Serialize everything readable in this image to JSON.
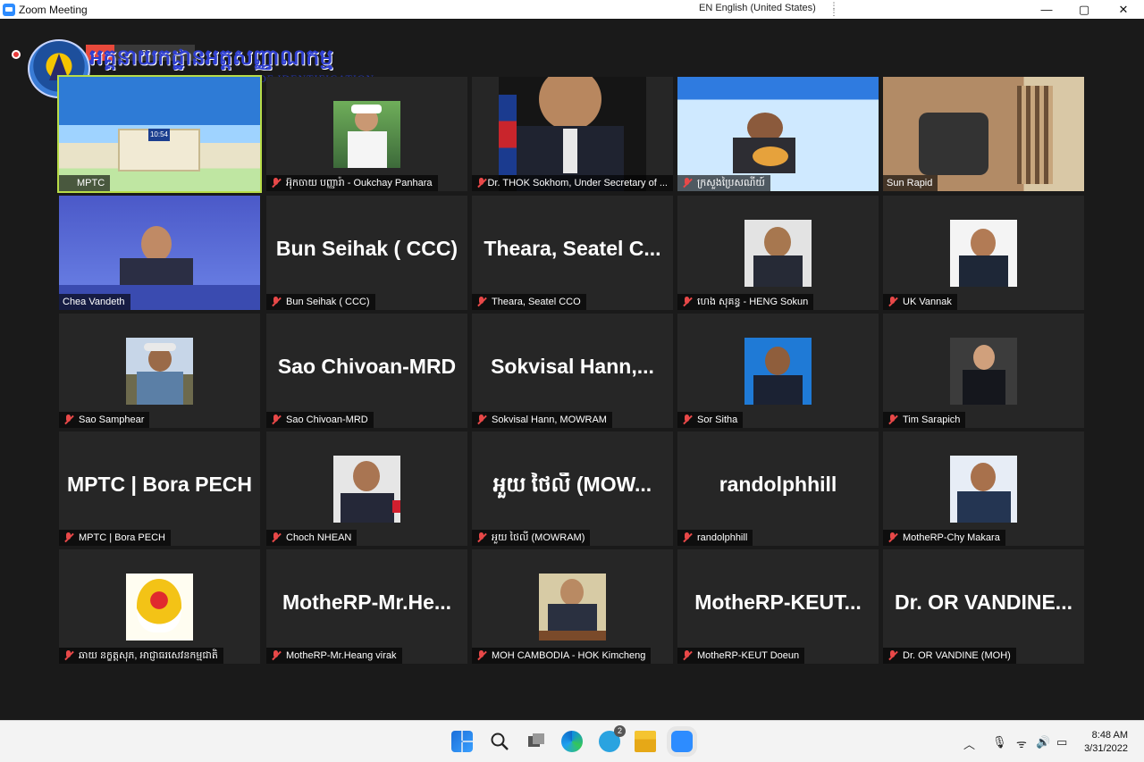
{
  "window": {
    "title": "Zoom Meeting",
    "language": "EN English (United States)",
    "lang_switch": "⋮\n⋮",
    "minimize": "—",
    "maximize": "▢",
    "close": "✕"
  },
  "banner": {
    "khmer_title": "អគ្គនាយកដ្ឋានអត្តសញ្ញាណកម្ម",
    "english_title": "GENERAL DEPARTMENT OF IDENTIFICATION",
    "recording_label": "ss"
  },
  "tiles": [
    {
      "name": "MPTC",
      "big": "",
      "type": "slide",
      "muted": false,
      "speaker": true
    },
    {
      "name": "អ៊ុកចាយ បញ្ញារ៉ា - Oukchay Panhara",
      "big": "",
      "type": "photo-officer",
      "muted": true
    },
    {
      "name": "Dr. THOK Sokhom, Under Secretary of ...",
      "big": "",
      "type": "video-suit",
      "muted": true
    },
    {
      "name": "ក្រសួងប្រៃសណីយ៍",
      "big": "",
      "type": "video-slide",
      "muted": true
    },
    {
      "name": "Sun Rapid",
      "big": "",
      "type": "video-chair",
      "muted": false
    },
    {
      "name": "Chea Vandeth",
      "big": "",
      "type": "video-presenter",
      "muted": false
    },
    {
      "name": "Bun Seihak ( CCC)",
      "big": "Bun Seihak ( CCC)",
      "type": "text",
      "muted": true
    },
    {
      "name": "Theara, Seatel CCO",
      "big": "Theara, Seatel C...",
      "type": "text",
      "muted": true
    },
    {
      "name": "ហេង សុគន្ធ - HENG Sokun",
      "big": "",
      "type": "photo-grey",
      "muted": true
    },
    {
      "name": "UK Vannak",
      "big": "",
      "type": "photo-white",
      "muted": true
    },
    {
      "name": "Sao Samphear",
      "big": "",
      "type": "photo-outdoor",
      "muted": true
    },
    {
      "name": "Sao Chivoan-MRD",
      "big": "Sao Chivoan-MRD",
      "type": "text",
      "muted": true
    },
    {
      "name": "Sokvisal Hann, MOWRAM",
      "big": "Sokvisal Hann,...",
      "type": "text",
      "muted": true
    },
    {
      "name": "Sor Sitha",
      "big": "",
      "type": "photo-blue",
      "muted": true
    },
    {
      "name": "Tim Sarapich",
      "big": "",
      "type": "photo-dark",
      "muted": true
    },
    {
      "name": "MPTC | Bora PECH",
      "big": "MPTC | Bora PECH",
      "type": "text",
      "muted": true
    },
    {
      "name": "Choch NHEAN",
      "big": "",
      "type": "photo-red",
      "muted": true
    },
    {
      "name": "អួយ ថៃលី (MOWRAM)",
      "big": "អួយ ថៃលី (MOW...",
      "type": "text",
      "muted": true
    },
    {
      "name": "randolphhill",
      "big": "randolphhill",
      "type": "text",
      "muted": true
    },
    {
      "name": "MotheRP-Chy Makara",
      "big": "",
      "type": "photo-blue2",
      "muted": true
    },
    {
      "name": "ឆាយ នក្ខត្តសុភ, អាជ្ញាធរសេវនកម្មជាតិ",
      "big": "",
      "type": "photo-emblem",
      "muted": true
    },
    {
      "name": "MotheRP-Mr.Heang virak",
      "big": "MotheRP-Mr.He...",
      "type": "text",
      "muted": true
    },
    {
      "name": "MOH CAMBODIA - HOK Kimcheng",
      "big": "",
      "type": "photo-desk",
      "muted": true
    },
    {
      "name": "MotheRP-KEUT Doeun",
      "big": "MotheRP-KEUT...",
      "type": "text",
      "muted": true
    },
    {
      "name": "Dr. OR VANDINE (MOH)",
      "big": "Dr. OR VANDINE...",
      "type": "text",
      "muted": true
    }
  ],
  "taskbar": {
    "time": "8:48 AM",
    "date": "3/31/2022",
    "telegram_badge": "2"
  },
  "colors": {
    "speaker_border": "#b8dc48",
    "tile_bg": "#262626",
    "muted_red": "#e84848"
  }
}
